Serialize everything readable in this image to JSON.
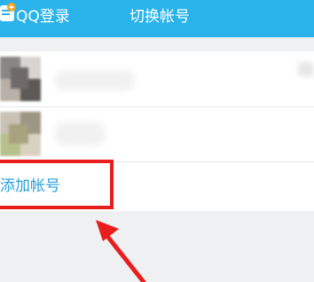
{
  "header": {
    "app_icon": "app-logo-icon",
    "title": "QQ登录",
    "switch_title": "切换帐号",
    "bg_color": "#2ab3ea"
  },
  "accounts": [
    {
      "avatar": "blurred-avatar"
    },
    {
      "avatar": "blurred-avatar"
    }
  ],
  "add_account": {
    "label": "添加帐号",
    "color": "#2a9fd8"
  },
  "annotation": {
    "box_color": "#e81e1e",
    "arrow_icon": "red-arrow-icon"
  }
}
